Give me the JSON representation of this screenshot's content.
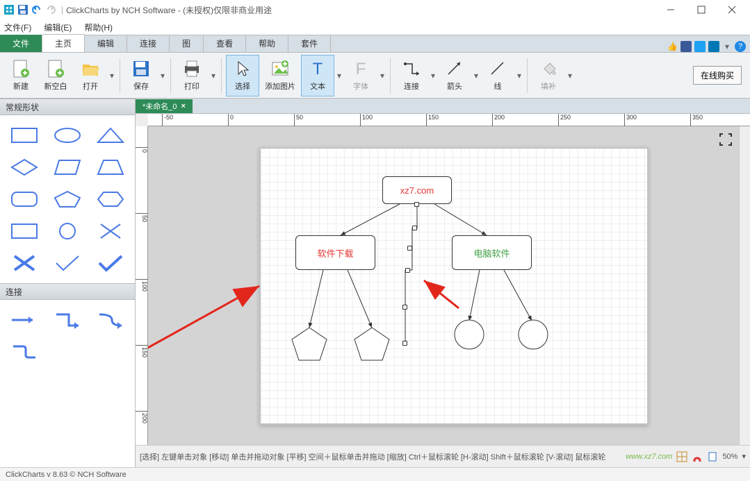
{
  "title": "ClickCharts by NCH Software - (未授权)仅限非商业用途",
  "menubar": {
    "file": "文件(F)",
    "edit": "编辑(E)",
    "help": "帮助(H)"
  },
  "tabs": {
    "file": "文件",
    "home": "主页",
    "edit": "编辑",
    "connect": "连接",
    "figure": "图",
    "view": "查看",
    "help": "帮助",
    "suite": "套件"
  },
  "ribbon": {
    "new": "新建",
    "new_blank": "新空白",
    "open": "打开",
    "save": "保存",
    "print": "打印",
    "select": "选择",
    "add_image": "添加图片",
    "text": "文本",
    "font": "字体",
    "connect": "连接",
    "arrow": "箭头",
    "line": "线",
    "fill": "填补",
    "buy": "在线购买"
  },
  "left_panel": {
    "shapes": "常规形状",
    "connect": "连接"
  },
  "doc_tab": "*未命名_0",
  "ruler_h": [
    "-50",
    "0",
    "50",
    "100",
    "150",
    "200",
    "250",
    "300",
    "350"
  ],
  "ruler_v": [
    "0",
    "50",
    "100",
    "150",
    "200"
  ],
  "nodes": {
    "root": "xz7.com",
    "left": "软件下载",
    "right": "电脑软件"
  },
  "help_text": "[选择] 左键单击对象 [移动] 单击并拖动对象 [平移] 空间＋鼠标单击并拖动 [缩放] Ctrl＋鼠标滚轮 [H-滚动] Shift＋鼠标滚轮 [V-滚动] 鼠标滚轮",
  "zoom": "50%",
  "status": "ClickCharts v 8.63 © NCH Software",
  "watermark": "www.xz7.com"
}
